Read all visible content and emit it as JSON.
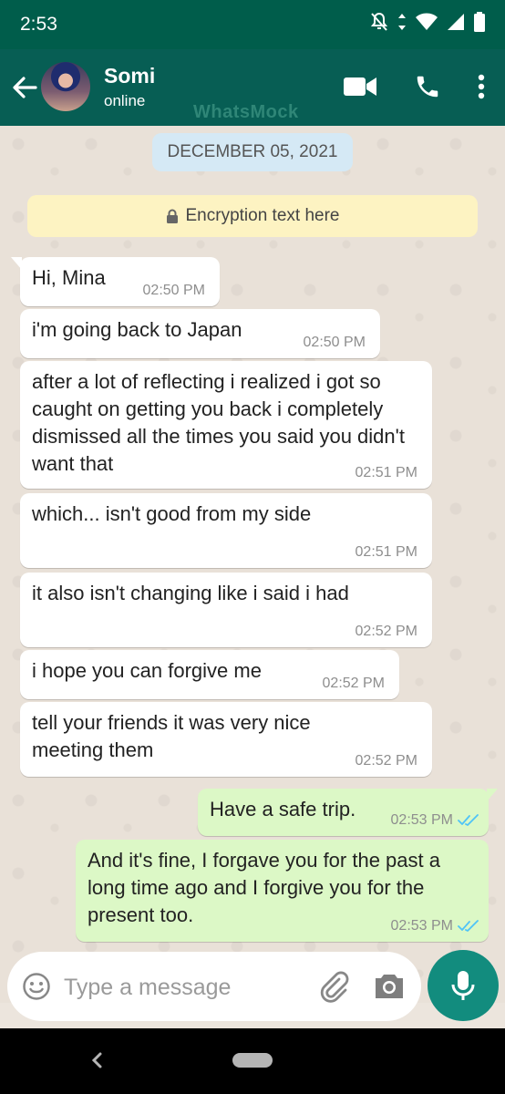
{
  "status_bar": {
    "time": "2:53",
    "icons": [
      "notifications-off-icon",
      "data-arrows-icon",
      "wifi-icon",
      "cell-signal-icon",
      "battery-icon"
    ]
  },
  "header": {
    "contact_name": "Somi",
    "contact_status": "online",
    "watermark": "WhatsMock",
    "actions": [
      "video-call-icon",
      "phone-icon",
      "more-vert-icon"
    ]
  },
  "chat": {
    "date_chip": "DECEMBER 05, 2021",
    "encryption_notice": "Encryption text here",
    "messages": [
      {
        "direction": "in",
        "text": "Hi, Mina",
        "time": "02:50 PM"
      },
      {
        "direction": "in",
        "text": "i'm going back to Japan",
        "time": "02:50 PM"
      },
      {
        "direction": "in",
        "text": "after a lot of reflecting i realized i got so caught on getting you back i completely dismissed all the times you said you didn't want that",
        "time": "02:51 PM"
      },
      {
        "direction": "in",
        "text": "which... isn't good from my side",
        "time": "02:51 PM"
      },
      {
        "direction": "in",
        "text": "it also isn't changing like i said i had",
        "time": "02:52 PM"
      },
      {
        "direction": "in",
        "text": "i hope you can forgive me",
        "time": "02:52 PM"
      },
      {
        "direction": "in",
        "text": "tell your friends it was very nice meeting them",
        "time": "02:52 PM"
      },
      {
        "direction": "out",
        "text": "Have a safe trip.",
        "time": "02:53 PM",
        "status": "read"
      },
      {
        "direction": "out",
        "text": "And it's fine, I forgave you for the past a long time ago and I forgive you for the present too.",
        "time": "02:53 PM",
        "status": "read"
      }
    ]
  },
  "composer": {
    "placeholder": "Type a message",
    "value": ""
  },
  "colors": {
    "header": "#075e54",
    "status_bar": "#005d4b",
    "incoming_bubble": "#ffffff",
    "outgoing_bubble": "#dcf8c6",
    "accent": "#128c7e",
    "read_ticks": "#4fc3f7"
  }
}
